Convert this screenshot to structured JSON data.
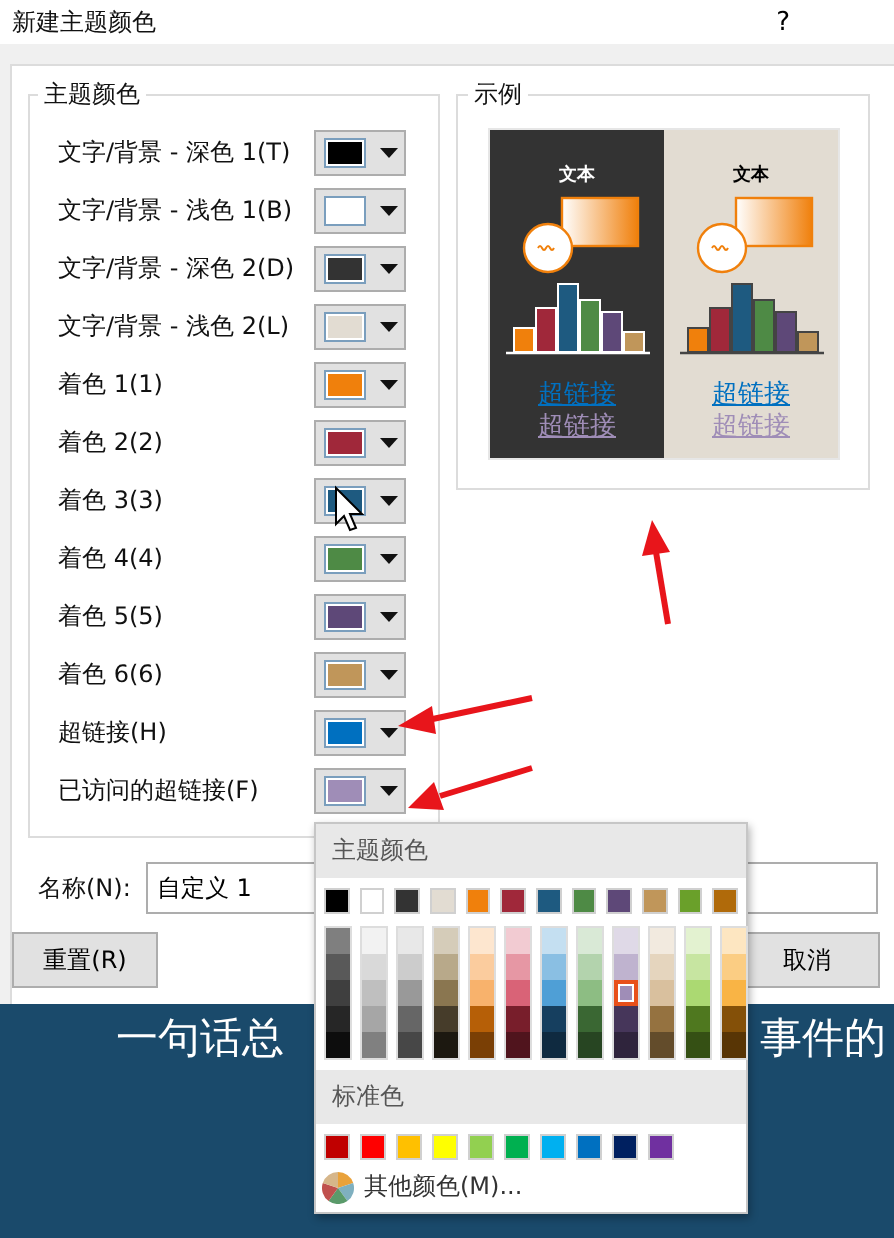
{
  "window": {
    "title": "新建主题颜色",
    "help": "?"
  },
  "theme_colors": {
    "title": "主题颜色",
    "items": [
      {
        "label": "文字/背景 - 深色 1(T)",
        "color": "#000000"
      },
      {
        "label": "文字/背景 - 浅色 1(B)",
        "color": "#ffffff"
      },
      {
        "label": "文字/背景 - 深色 2(D)",
        "color": "#333333"
      },
      {
        "label": "文字/背景 - 浅色 2(L)",
        "color": "#e2dcd2"
      },
      {
        "label": "着色 1(1)",
        "color": "#f0800c"
      },
      {
        "label": "着色 2(2)",
        "color": "#a0283a"
      },
      {
        "label": "着色 3(3)",
        "color": "#1e5a80"
      },
      {
        "label": "着色 4(4)",
        "color": "#4e8a45"
      },
      {
        "label": "着色 5(5)",
        "color": "#5e4878"
      },
      {
        "label": "着色 6(6)",
        "color": "#c0965a"
      },
      {
        "label": "超链接(H)",
        "color": "#0070c0"
      },
      {
        "label": "已访问的超链接(F)",
        "color": "#9f8db7"
      }
    ]
  },
  "sample": {
    "title": "示例",
    "panels": [
      {
        "kind": "dark",
        "heading": "文本",
        "links": [
          "超链接",
          "超链接"
        ]
      },
      {
        "kind": "light",
        "heading": "文本",
        "links": [
          "超链接",
          "超链接"
        ]
      }
    ]
  },
  "name_field": {
    "label": "名称(N):",
    "value": "自定义 1"
  },
  "buttons": [
    {
      "label": "重置(R)"
    },
    {
      "label": "取消"
    }
  ],
  "slide": {
    "texts": [
      "一句话总",
      "事件的"
    ]
  },
  "color_menu": {
    "theme_title": "主题颜色",
    "theme_row": [
      {
        "color": "#000000"
      },
      {
        "color": "#ffffff"
      },
      {
        "color": "#333333"
      },
      {
        "color": "#e2dcd2"
      },
      {
        "color": "#f0800c"
      },
      {
        "color": "#a0283a"
      },
      {
        "color": "#1e5a80"
      },
      {
        "color": "#4e8a45"
      },
      {
        "color": "#5e4878"
      },
      {
        "color": "#c0965a"
      },
      {
        "color": "#6aa02a"
      },
      {
        "color": "#b06a0a"
      }
    ],
    "shade_columns": [
      {
        "shades": [
          {
            "color": "#7f7f7f",
            "selected": false
          },
          {
            "color": "#595959",
            "selected": false
          },
          {
            "color": "#3f3f3f",
            "selected": false
          },
          {
            "color": "#262626",
            "selected": false
          },
          {
            "color": "#0d0d0d",
            "selected": false
          }
        ]
      },
      {
        "shades": [
          {
            "color": "#f2f2f2",
            "selected": false
          },
          {
            "color": "#d9d9d9",
            "selected": false
          },
          {
            "color": "#bfbfbf",
            "selected": false
          },
          {
            "color": "#a6a6a6",
            "selected": false
          },
          {
            "color": "#808080",
            "selected": false
          }
        ]
      },
      {
        "shades": [
          {
            "color": "#e8e8e8",
            "selected": false
          },
          {
            "color": "#cccccc",
            "selected": false
          },
          {
            "color": "#999999",
            "selected": false
          },
          {
            "color": "#666666",
            "selected": false
          },
          {
            "color": "#474747",
            "selected": false
          }
        ]
      },
      {
        "shades": [
          {
            "color": "#d5ccb9",
            "selected": false
          },
          {
            "color": "#b8a98a",
            "selected": false
          },
          {
            "color": "#8a7650",
            "selected": false
          },
          {
            "color": "#463c2a",
            "selected": false
          },
          {
            "color": "#1c1810",
            "selected": false
          }
        ]
      },
      {
        "shades": [
          {
            "color": "#fde6cf",
            "selected": false
          },
          {
            "color": "#fbcc9e",
            "selected": false
          },
          {
            "color": "#f8b26c",
            "selected": false
          },
          {
            "color": "#b65f07",
            "selected": false
          },
          {
            "color": "#7a3f05",
            "selected": false
          }
        ]
      },
      {
        "shades": [
          {
            "color": "#f2cbd2",
            "selected": false
          },
          {
            "color": "#e697a4",
            "selected": false
          },
          {
            "color": "#d96377",
            "selected": false
          },
          {
            "color": "#781e2b",
            "selected": false
          },
          {
            "color": "#50141d",
            "selected": false
          }
        ]
      },
      {
        "shades": [
          {
            "color": "#c4dff1",
            "selected": false
          },
          {
            "color": "#8abfe3",
            "selected": false
          },
          {
            "color": "#4f9fd6",
            "selected": false
          },
          {
            "color": "#163f5f",
            "selected": false
          },
          {
            "color": "#0f2a40",
            "selected": false
          }
        ]
      },
      {
        "shades": [
          {
            "color": "#d9e9d6",
            "selected": false
          },
          {
            "color": "#b3d3ad",
            "selected": false
          },
          {
            "color": "#8dbd83",
            "selected": false
          },
          {
            "color": "#3a6733",
            "selected": false
          },
          {
            "color": "#274522",
            "selected": false
          }
        ]
      },
      {
        "shades": [
          {
            "color": "#dfd9e7",
            "selected": false
          },
          {
            "color": "#bfb3cf",
            "selected": false
          },
          {
            "color": "#9f8db7",
            "selected": true
          },
          {
            "color": "#46365a",
            "selected": false
          },
          {
            "color": "#2f243c",
            "selected": false
          }
        ]
      },
      {
        "shades": [
          {
            "color": "#f2eadf",
            "selected": false
          },
          {
            "color": "#e5d5be",
            "selected": false
          },
          {
            "color": "#d9c09e",
            "selected": false
          },
          {
            "color": "#957240",
            "selected": false
          },
          {
            "color": "#634c2b",
            "selected": false
          }
        ]
      },
      {
        "shades": [
          {
            "color": "#e3f2d0",
            "selected": false
          },
          {
            "color": "#c7e5a1",
            "selected": false
          },
          {
            "color": "#abd972",
            "selected": false
          },
          {
            "color": "#4f781f",
            "selected": false
          },
          {
            "color": "#355014",
            "selected": false
          }
        ]
      },
      {
        "shades": [
          {
            "color": "#fde6c1",
            "selected": false
          },
          {
            "color": "#fbcd83",
            "selected": false
          },
          {
            "color": "#f9b445",
            "selected": false
          },
          {
            "color": "#845008",
            "selected": false
          },
          {
            "color": "#583505",
            "selected": false
          }
        ]
      }
    ],
    "standard_title": "标准色",
    "standard": [
      {
        "color": "#c00000"
      },
      {
        "color": "#ff0000"
      },
      {
        "color": "#ffc000"
      },
      {
        "color": "#ffff00"
      },
      {
        "color": "#92d050"
      },
      {
        "color": "#00b050"
      },
      {
        "color": "#00b0f0"
      },
      {
        "color": "#0070c0"
      },
      {
        "color": "#002060"
      },
      {
        "color": "#7030a0"
      }
    ],
    "more": "其他颜色(M)..."
  }
}
